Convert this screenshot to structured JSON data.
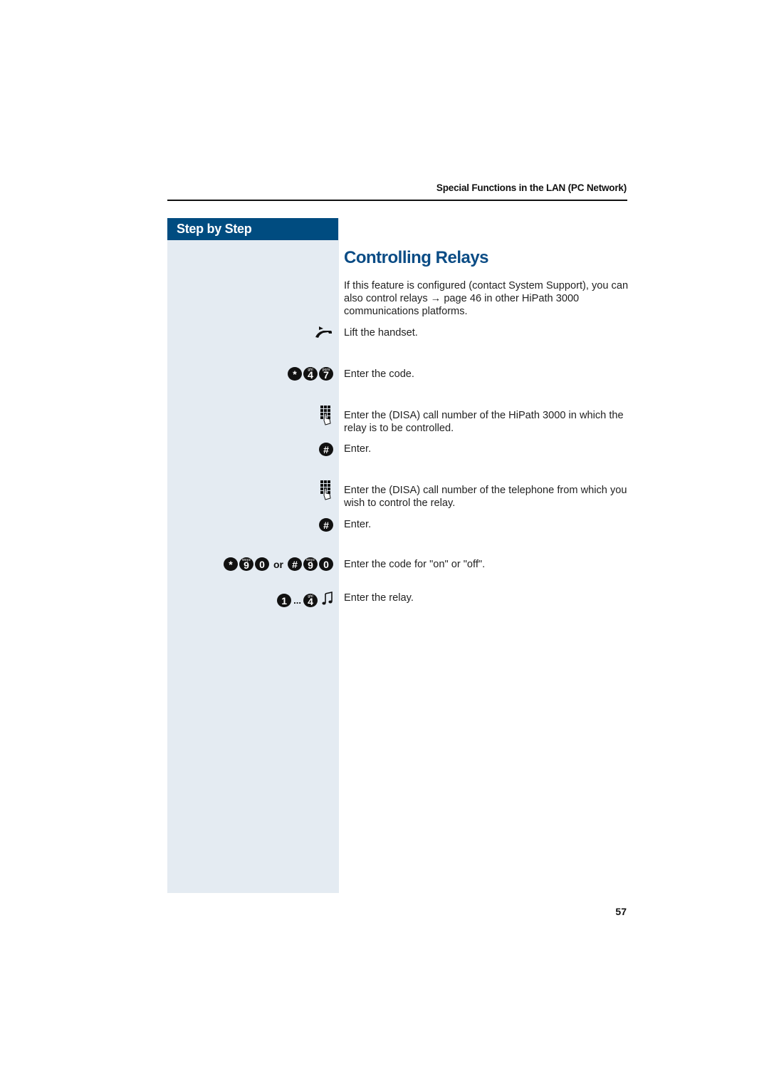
{
  "header": {
    "running_title": "Special Functions in the LAN (PC Network)"
  },
  "sidebar": {
    "title": "Step by Step"
  },
  "main": {
    "title": "Controlling Relays",
    "intro": "If this feature is configured (contact System Support), you can also control relays → page 46 in other HiPath 3000 communications platforms.",
    "steps": [
      {
        "icon": "lift-handset-icon",
        "text": "Lift the handset."
      },
      {
        "icon": "keys-star-4-7",
        "keys": [
          "*",
          "4",
          "7"
        ],
        "key_subs": [
          "",
          "ghi",
          "pqrs"
        ],
        "text": "Enter the code."
      },
      {
        "icon": "keypad-icon",
        "text": "Enter the (DISA) call number of the HiPath 3000 in which the relay is to be controlled."
      },
      {
        "icon": "hash-key-icon",
        "keys": [
          "#"
        ],
        "text": "Enter."
      },
      {
        "icon": "keypad-icon",
        "text": "Enter the (DISA) call number of the telephone from which you wish to control the relay."
      },
      {
        "icon": "hash-key-icon",
        "keys": [
          "#"
        ],
        "text": "Enter."
      },
      {
        "icon": "keys-on-off",
        "keys_on": [
          "*",
          "9",
          "0"
        ],
        "or_label": "or",
        "keys_off": [
          "#",
          "9",
          "0"
        ],
        "key_sub_9": "wxyz",
        "text": "Enter the code for \"on\" or \"off\"."
      },
      {
        "icon": "keys-1-to-4",
        "keys": [
          "1",
          "4"
        ],
        "range_label": "...",
        "key_sub_4": "ghi",
        "tone": "tone-icon",
        "text": "Enter the relay."
      }
    ]
  },
  "footer": {
    "page_number": "57"
  },
  "colors": {
    "brand_blue": "#004c80",
    "title_blue": "#0b4c85",
    "panel_bg": "#e4ebf2"
  }
}
